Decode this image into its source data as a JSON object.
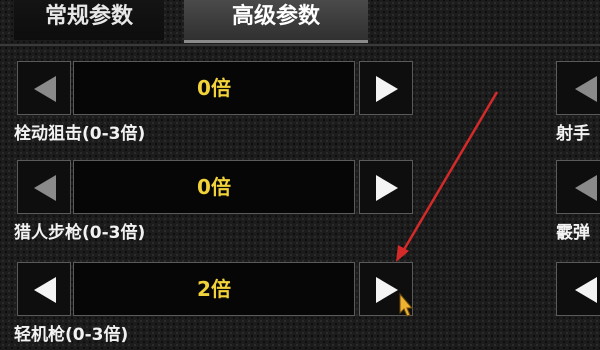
{
  "tabs": [
    {
      "label": "常规参数",
      "active": false
    },
    {
      "label": "高级参数",
      "active": true
    }
  ],
  "settings": [
    {
      "value": "0倍",
      "label": "栓动狙击(0-3倍)",
      "left_state": "disabled",
      "right_state": "enabled"
    },
    {
      "value": "0倍",
      "label": "猎人步枪(0-3倍)",
      "left_state": "disabled",
      "right_state": "enabled"
    },
    {
      "value": "2倍",
      "label": "轻机枪(0-3倍)",
      "left_state": "enabled",
      "right_state": "enabled"
    }
  ],
  "right_column": [
    {
      "label": "射手"
    },
    {
      "label": "霰弹"
    },
    {
      "label": ""
    }
  ],
  "colors": {
    "value_text": "#f2d23a",
    "annotation_arrow": "#d42a2a",
    "cursor": "#f0b030"
  },
  "icons": {
    "left_arrow": "triangle-left-icon",
    "right_arrow": "triangle-right-icon",
    "cursor": "mouse-pointer-icon"
  }
}
